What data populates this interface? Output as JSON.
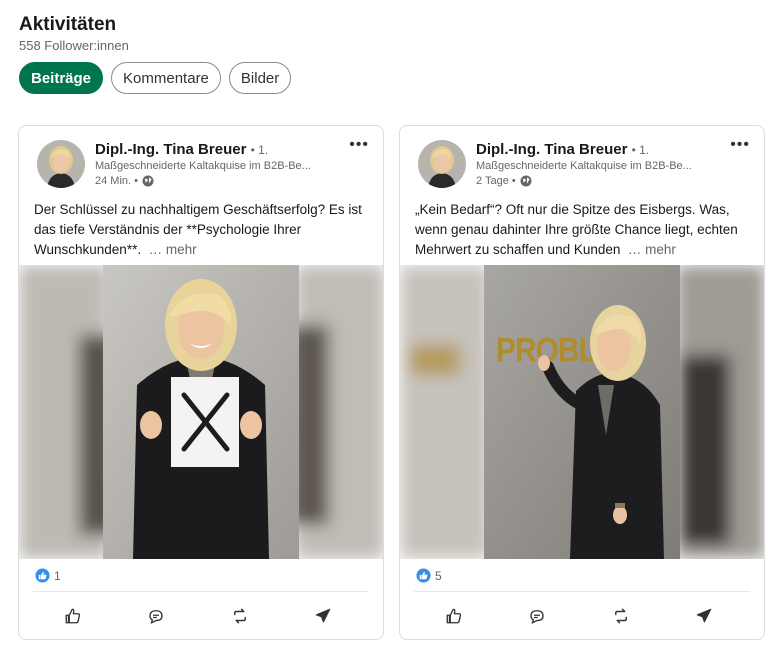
{
  "section": {
    "title": "Aktivitäten",
    "followers": "558 Follower:innen"
  },
  "filters": [
    {
      "label": "Beiträge",
      "active": true
    },
    {
      "label": "Kommentare",
      "active": false
    },
    {
      "label": "Bilder",
      "active": false
    }
  ],
  "posts": [
    {
      "author": "Dipl.-Ing. Tina Breuer",
      "degree": "• 1.",
      "headline": "Maßgeschneiderte Kaltakquise im B2B-Be...",
      "time": "24 Min. •",
      "text": "Der Schlüssel zu nachhaltigem Geschäftserfolg? Es ist das tiefe Verständnis der **Psychologie Ihrer Wunschkunden**.",
      "more": "… mehr",
      "reaction_count": "1",
      "image_sign": "X"
    },
    {
      "author": "Dipl.-Ing. Tina Breuer",
      "degree": "• 1.",
      "headline": "Maßgeschneiderte Kaltakquise im B2B-Be...",
      "time": "2 Tage •",
      "text": "„Kein Bedarf“? Oft nur die Spitze des Eisbergs. Was, wenn genau dahinter Ihre größte Chance liegt, echten Mehrwert zu schaffen und Kunden",
      "more": "… mehr",
      "reaction_count": "5",
      "image_word": "PROBLEM"
    }
  ],
  "colors": {
    "primary": "#01754f",
    "like_blue": "#378fe9",
    "text": "#191919",
    "muted": "#666666"
  },
  "icons": [
    "globe-icon",
    "more-icon",
    "like-reaction-icon",
    "like-icon",
    "comment-icon",
    "repost-icon",
    "send-icon"
  ]
}
